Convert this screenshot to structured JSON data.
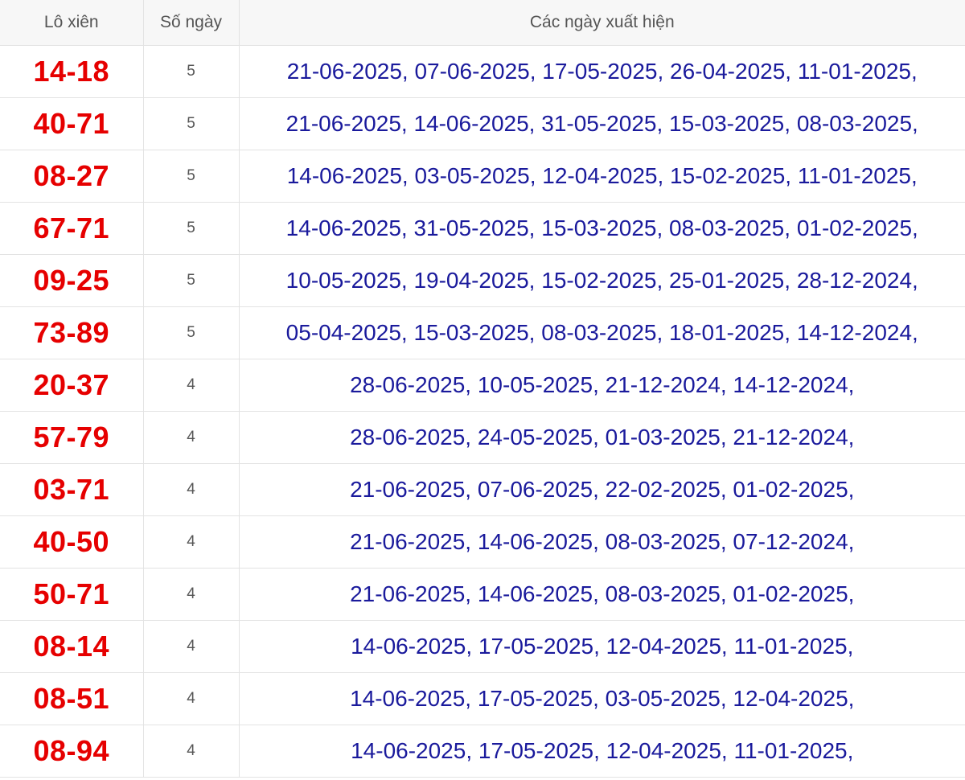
{
  "table": {
    "headers": [
      "Lô xiên",
      "Số ngày",
      "Các ngày xuất hiện"
    ],
    "rows": [
      {
        "pair": "14-18",
        "days": "5",
        "dates": "21-06-2025, 07-06-2025, 17-05-2025, 26-04-2025, 11-01-2025,"
      },
      {
        "pair": "40-71",
        "days": "5",
        "dates": "21-06-2025, 14-06-2025, 31-05-2025, 15-03-2025, 08-03-2025,"
      },
      {
        "pair": "08-27",
        "days": "5",
        "dates": "14-06-2025, 03-05-2025, 12-04-2025, 15-02-2025, 11-01-2025,"
      },
      {
        "pair": "67-71",
        "days": "5",
        "dates": "14-06-2025, 31-05-2025, 15-03-2025, 08-03-2025, 01-02-2025,"
      },
      {
        "pair": "09-25",
        "days": "5",
        "dates": "10-05-2025, 19-04-2025, 15-02-2025, 25-01-2025, 28-12-2024,"
      },
      {
        "pair": "73-89",
        "days": "5",
        "dates": "05-04-2025, 15-03-2025, 08-03-2025, 18-01-2025, 14-12-2024,"
      },
      {
        "pair": "20-37",
        "days": "4",
        "dates": "28-06-2025, 10-05-2025, 21-12-2024, 14-12-2024,"
      },
      {
        "pair": "57-79",
        "days": "4",
        "dates": "28-06-2025, 24-05-2025, 01-03-2025, 21-12-2024,"
      },
      {
        "pair": "03-71",
        "days": "4",
        "dates": "21-06-2025, 07-06-2025, 22-02-2025, 01-02-2025,"
      },
      {
        "pair": "40-50",
        "days": "4",
        "dates": "21-06-2025, 14-06-2025, 08-03-2025, 07-12-2024,"
      },
      {
        "pair": "50-71",
        "days": "4",
        "dates": "21-06-2025, 14-06-2025, 08-03-2025, 01-02-2025,"
      },
      {
        "pair": "08-14",
        "days": "4",
        "dates": "14-06-2025, 17-05-2025, 12-04-2025, 11-01-2025,"
      },
      {
        "pair": "08-51",
        "days": "4",
        "dates": "14-06-2025, 17-05-2025, 03-05-2025, 12-04-2025,"
      },
      {
        "pair": "08-94",
        "days": "4",
        "dates": "14-06-2025, 17-05-2025, 12-04-2025, 11-01-2025,"
      }
    ]
  },
  "colors": {
    "pair_text": "#e60000",
    "date_text": "#1a1a9c",
    "header_text": "#555555",
    "border": "#e3e3e3",
    "header_bg": "#f7f7f7"
  }
}
